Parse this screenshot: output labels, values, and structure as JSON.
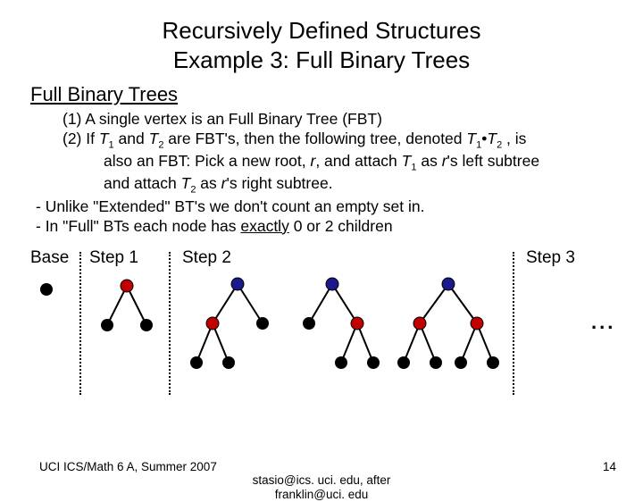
{
  "title_l1": "Recursively Defined Structures",
  "title_l2": "Example 3: Full Binary Trees",
  "subhead": "Full Binary Trees",
  "def1": "(1) A single vertex is an Full Binary Tree (FBT)",
  "def2_a": "(2) If ",
  "def2_b": " and ",
  "def2_c": " are FBT's, then the following tree, denoted ",
  "def2_d": " , is",
  "def2_cont1_a": "also an FBT:  Pick a new root, ",
  "def2_cont1_b": ", and attach ",
  "def2_cont1_c": " as ",
  "def2_cont1_d": "'s left subtree",
  "def2_cont2_a": "and attach ",
  "def2_cont2_b": "  as ",
  "def2_cont2_c": "'s right subtree.",
  "r": "r",
  "T": "T",
  "one": "1",
  "two": "2",
  "dot": "•",
  "bul1": "-  Unlike \"Extended\" BT's we don't count an empty set in.",
  "bul2_a": "-  In \"Full\" BTs each node has ",
  "bul2_b": "exactly",
  "bul2_c": " 0 or 2 children",
  "labels": {
    "base": "Base",
    "s1": "Step 1",
    "s2": "Step 2",
    "s3": "Step 3"
  },
  "ellipsis": "...",
  "footer": {
    "left": "UCI ICS/Math 6 A, Summer 2007",
    "center1": "stasio@ics. uci. edu, after",
    "center2": "franklin@uci. edu",
    "page": "14"
  }
}
